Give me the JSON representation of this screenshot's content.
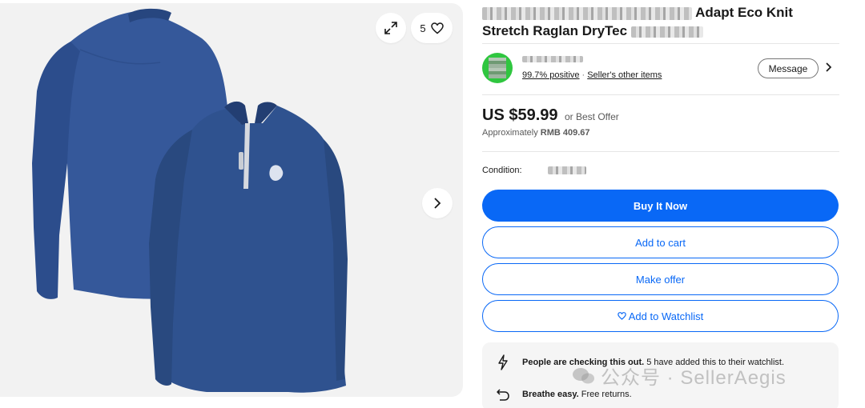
{
  "gallery": {
    "image_count": "5",
    "expand_icon": "expand-icon",
    "favorite_icon": "heart-icon",
    "next_icon": "chevron-right-icon"
  },
  "listing": {
    "title_visible_part1": "Adapt Eco Knit",
    "title_visible_part2": "Stretch Raglan DryTec"
  },
  "seller": {
    "feedback": "99.7% positive",
    "other_items": "Seller's other items",
    "message_label": "Message"
  },
  "pricing": {
    "price": "US $59.99",
    "best_offer": "or Best Offer",
    "approx_label": "Approximately",
    "approx_value": "RMB 409.67"
  },
  "condition": {
    "label": "Condition:"
  },
  "actions": {
    "buy_now": "Buy It Now",
    "add_to_cart": "Add to cart",
    "make_offer": "Make offer",
    "add_to_watchlist": "Add to Watchlist"
  },
  "signals": {
    "watch_bold": "People are checking this out.",
    "watch_text": "5 have added this to their watchlist.",
    "returns_bold": "Breathe easy.",
    "returns_text": "Free returns."
  },
  "watermark": {
    "text": "公众号 · SellerAegis"
  },
  "colors": {
    "primary_blue": "#0968f6",
    "shirt_navy": "#2f4f8f",
    "avatar_green": "#2fc63f"
  }
}
